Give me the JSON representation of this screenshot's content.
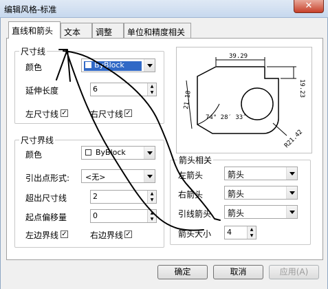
{
  "window": {
    "title": "编辑风格-标准",
    "close_glyph": "✕"
  },
  "tabs": [
    "直线和箭头",
    "文本",
    "调整",
    "单位和精度相关"
  ],
  "dim_line": {
    "group_title": "尺寸线",
    "color_label": "颜色",
    "color_value": "ByBlock",
    "extend_label": "延伸长度",
    "extend_value": "6",
    "left_check_label": "左尺寸线",
    "left_checked": true,
    "right_check_label": "右尺寸线",
    "right_checked": true
  },
  "ext_line": {
    "group_title": "尺寸界线",
    "color_label": "颜色",
    "color_value": "ByBlock",
    "origin_label": "引出点形式:",
    "origin_value": "<无>",
    "beyond_label": "超出尺寸线",
    "beyond_value": "2",
    "offset_label": "起点偏移量",
    "offset_value": "0",
    "left_check_label": "左边界线",
    "left_checked": true,
    "right_check_label": "右边界线",
    "right_checked": true
  },
  "preview": {
    "dim_top": "39.29",
    "dim_right": "19.23",
    "dim_left": "21.18",
    "dim_angle": "74° 28′ 33″",
    "dim_radius": "R21.42"
  },
  "arrows": {
    "group_title": "箭头相关",
    "left_label": "左箭头",
    "left_value": "箭头",
    "right_label": "右箭头",
    "right_value": "箭头",
    "leader_label": "引线箭头",
    "leader_value": "箭头",
    "size_label": "箭头大小",
    "size_value": "4"
  },
  "buttons": {
    "ok": "确定",
    "cancel": "取消",
    "apply": "应用(A)"
  },
  "colors": {
    "accent_selection": "#3169c6",
    "annotation_ink": "#000000"
  }
}
